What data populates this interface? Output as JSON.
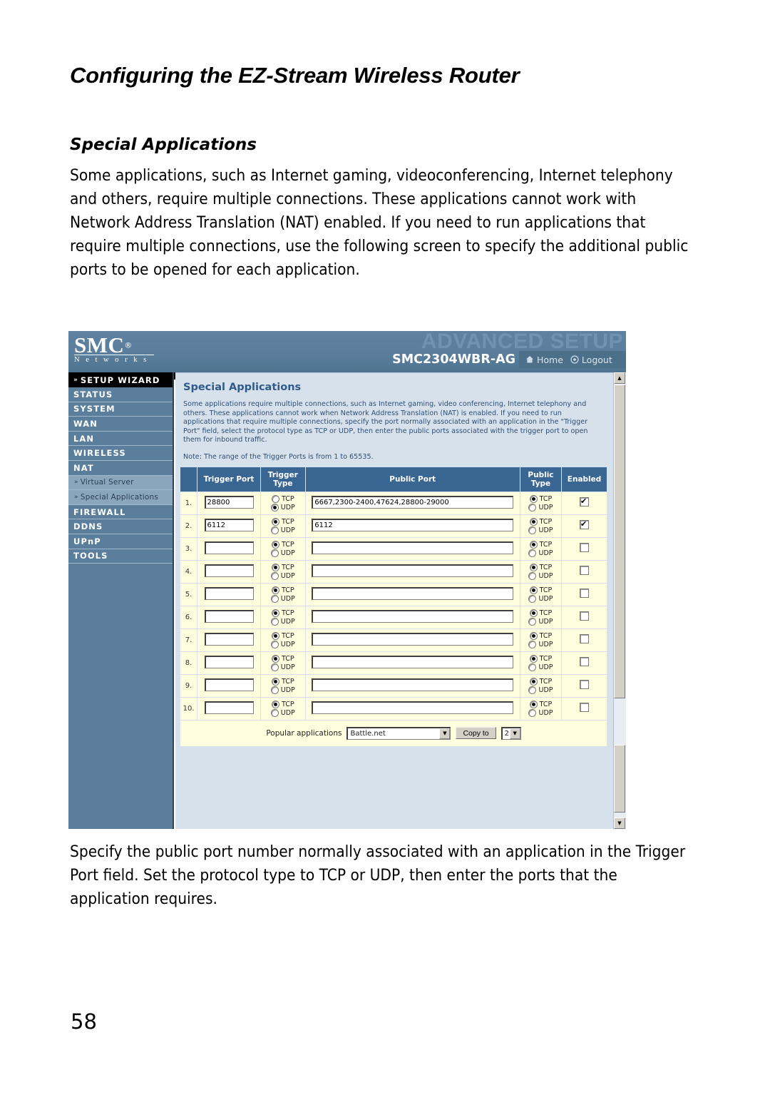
{
  "document": {
    "running_head": "Configuring the EZ-Stream Wireless Router",
    "section_heading": "Special Applications",
    "intro_paragraph": "Some applications, such as Internet gaming, videoconferencing, Internet telephony and others, require multiple connections. These applications cannot work with Network Address Translation (NAT) enabled. If you need to run applications that require multiple connections, use the following screen to specify the additional public ports to be opened for each application.",
    "closing_paragraph": "Specify the public port number normally associated with an application in the Trigger Port field. Set the protocol type to TCP or UDP, then enter the ports that the application requires.",
    "page_number": "58"
  },
  "router_ui": {
    "brand": {
      "name": "SMC",
      "registered_mark": "®",
      "tagline": "N e t w o r k s"
    },
    "header": {
      "banner_text": "ADVANCED SETUP",
      "model": "SMC2304WBR-AG",
      "home_label": "Home",
      "logout_label": "Logout",
      "home_icon": "home-icon",
      "logout_icon": "power-logout-icon",
      "banner_color": "#6f93b0",
      "header_bg": "#5a7e9c"
    },
    "sidebar": {
      "wizard_label": "SETUP WIZARD",
      "items": [
        {
          "label": "STATUS",
          "type": "main"
        },
        {
          "label": "SYSTEM",
          "type": "main"
        },
        {
          "label": "WAN",
          "type": "main"
        },
        {
          "label": "LAN",
          "type": "main"
        },
        {
          "label": "WIRELESS",
          "type": "main"
        },
        {
          "label": "NAT",
          "type": "main"
        },
        {
          "label": "Virtual Server",
          "type": "sub"
        },
        {
          "label": "Special Applications",
          "type": "sub"
        },
        {
          "label": "FIREWALL",
          "type": "main"
        },
        {
          "label": "DDNS",
          "type": "main"
        },
        {
          "label": "UPnP",
          "type": "main"
        },
        {
          "label": "TOOLS",
          "type": "main"
        }
      ]
    },
    "panel": {
      "title": "Special Applications",
      "description": "Some applications require multiple connections, such as Internet gaming, video conferencing, Internet telephony and others. These applications cannot work when Network Address Translation (NAT) is enabled. If you need to run applications that require multiple connections, specify the port normally associated with an application in the \"Trigger Port\" field, select the protocol type as TCP or UDP, then enter the public ports associated with the trigger port to open them for inbound traffic.",
      "note": "Note: The range of the Trigger Ports is from 1 to 65535."
    },
    "table": {
      "headers": {
        "index": "",
        "trigger_port": "Trigger Port",
        "trigger_type": "Trigger Type",
        "public_port": "Public Port",
        "public_type": "Public Type",
        "enabled": "Enabled"
      },
      "protocol_options": {
        "tcp": "TCP",
        "udp": "UDP"
      },
      "rows": [
        {
          "index": "1.",
          "trigger_port": "28800",
          "trigger_type": "UDP",
          "public_port": "6667,2300-2400,47624,28800-29000",
          "public_type": "TCP",
          "enabled": true
        },
        {
          "index": "2.",
          "trigger_port": "6112",
          "trigger_type": "TCP",
          "public_port": "6112",
          "public_type": "TCP",
          "enabled": true
        },
        {
          "index": "3.",
          "trigger_port": "",
          "trigger_type": "TCP",
          "public_port": "",
          "public_type": "TCP",
          "enabled": false
        },
        {
          "index": "4.",
          "trigger_port": "",
          "trigger_type": "TCP",
          "public_port": "",
          "public_type": "TCP",
          "enabled": false
        },
        {
          "index": "5.",
          "trigger_port": "",
          "trigger_type": "TCP",
          "public_port": "",
          "public_type": "TCP",
          "enabled": false
        },
        {
          "index": "6.",
          "trigger_port": "",
          "trigger_type": "TCP",
          "public_port": "",
          "public_type": "TCP",
          "enabled": false
        },
        {
          "index": "7.",
          "trigger_port": "",
          "trigger_type": "TCP",
          "public_port": "",
          "public_type": "TCP",
          "enabled": false
        },
        {
          "index": "8.",
          "trigger_port": "",
          "trigger_type": "TCP",
          "public_port": "",
          "public_type": "TCP",
          "enabled": false
        },
        {
          "index": "9.",
          "trigger_port": "",
          "trigger_type": "TCP",
          "public_port": "",
          "public_type": "TCP",
          "enabled": false
        },
        {
          "index": "10.",
          "trigger_port": "",
          "trigger_type": "TCP",
          "public_port": "",
          "public_type": "TCP",
          "enabled": false
        }
      ],
      "footer": {
        "popular_apps_label": "Popular applications",
        "popular_apps_selected": "Battle.net",
        "copy_to_label": "Copy to",
        "copy_target_selected": "2"
      }
    }
  }
}
